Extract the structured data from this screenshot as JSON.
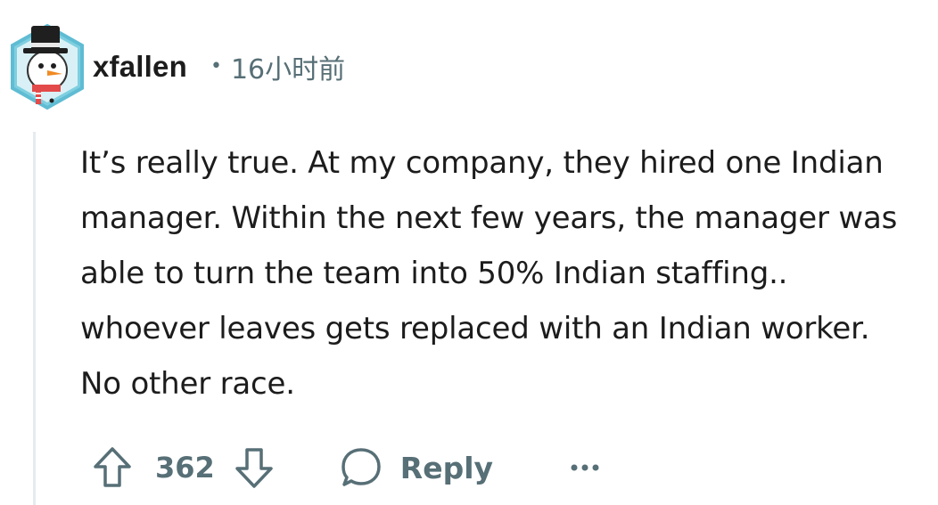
{
  "comment": {
    "username": "xfallen",
    "separator": "•",
    "timestamp": "16小时前",
    "body": "It’s really true. At my company, they hired one Indian manager. Within the next few years, the manager was able to turn the team into 50% Indian staffing.. whoever leaves gets replaced with an Indian worker. No other race.",
    "score": "362",
    "reply_label": "Reply"
  },
  "icons": {
    "avatar": "snowman-avatar",
    "upvote": "arrow-up-outline-icon",
    "downvote": "arrow-down-outline-icon",
    "reply": "speech-bubble-icon",
    "more": "ellipsis-icon"
  },
  "colors": {
    "text": "#1c1c1c",
    "meta": "#576f76",
    "thread_line": "#e5ebee"
  }
}
